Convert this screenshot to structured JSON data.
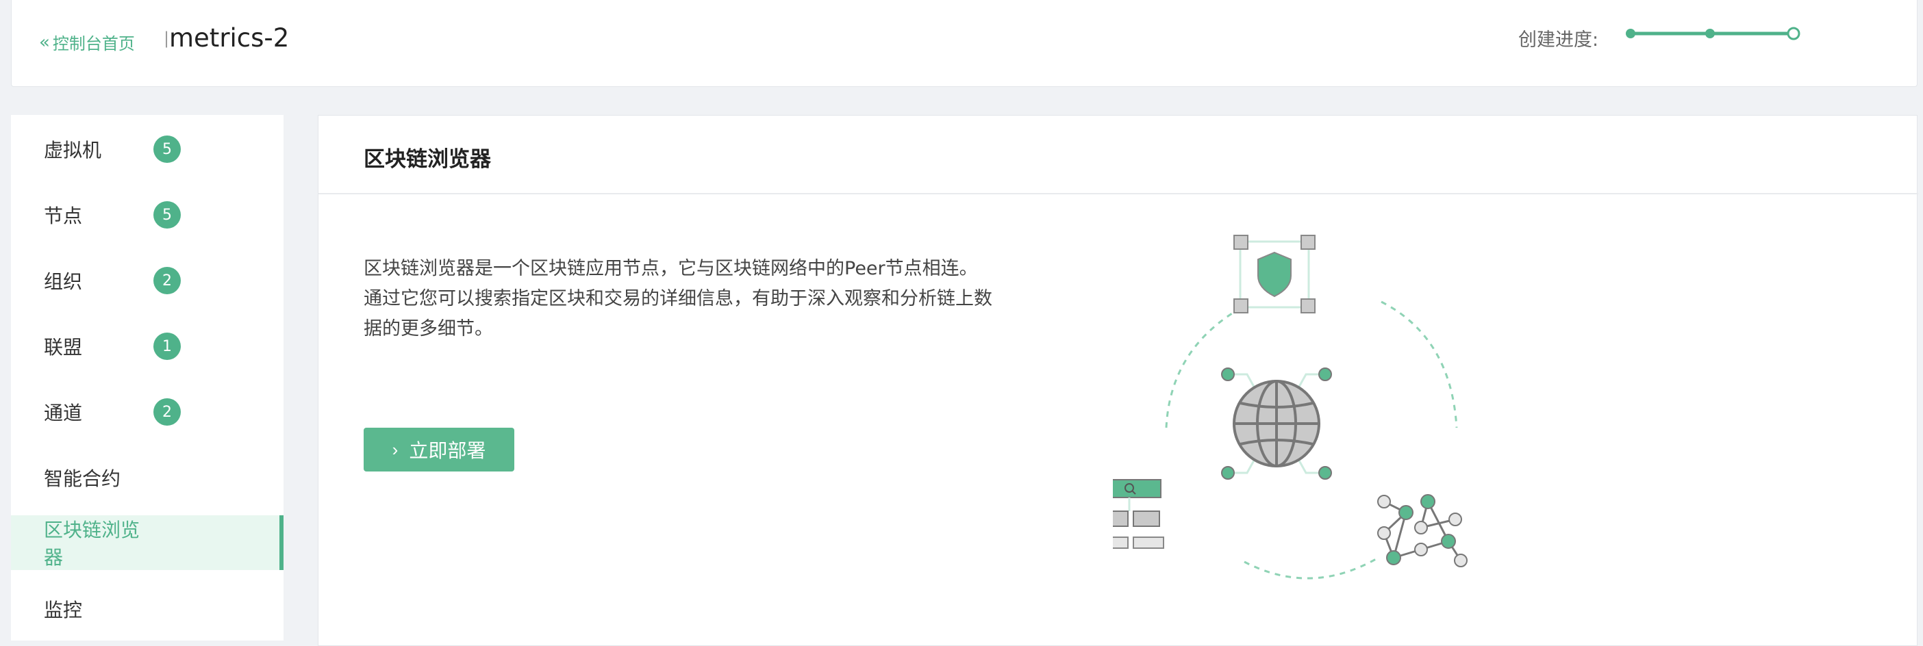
{
  "header": {
    "back_label": "控制台首页",
    "separator": "|",
    "title": "metrics-2",
    "progress_label": "创建进度:",
    "progress_steps_done": 2,
    "progress_steps_total": 3
  },
  "sidebar": {
    "items": [
      {
        "label": "虚拟机",
        "badge": "5"
      },
      {
        "label": "节点",
        "badge": "5"
      },
      {
        "label": "组织",
        "badge": "2"
      },
      {
        "label": "联盟",
        "badge": "1"
      },
      {
        "label": "通道",
        "badge": "2"
      },
      {
        "label": "智能合约"
      },
      {
        "label": "区块链浏览器",
        "active": true
      },
      {
        "label": "监控"
      }
    ]
  },
  "main": {
    "title": "区块链浏览器",
    "description": "区块链浏览器是一个区块链应用节点，它与区块链网络中的Peer节点相连。通过它您可以搜索指定区块和交易的详细信息，有助于深入观察和分析链上数据的更多细节。",
    "deploy_label": "立即部署"
  },
  "colors": {
    "accent": "#4fb28a",
    "button": "#5bb88f"
  },
  "icons": {
    "back": "double-chevron-left-icon",
    "deploy": "chevron-right-icon"
  }
}
